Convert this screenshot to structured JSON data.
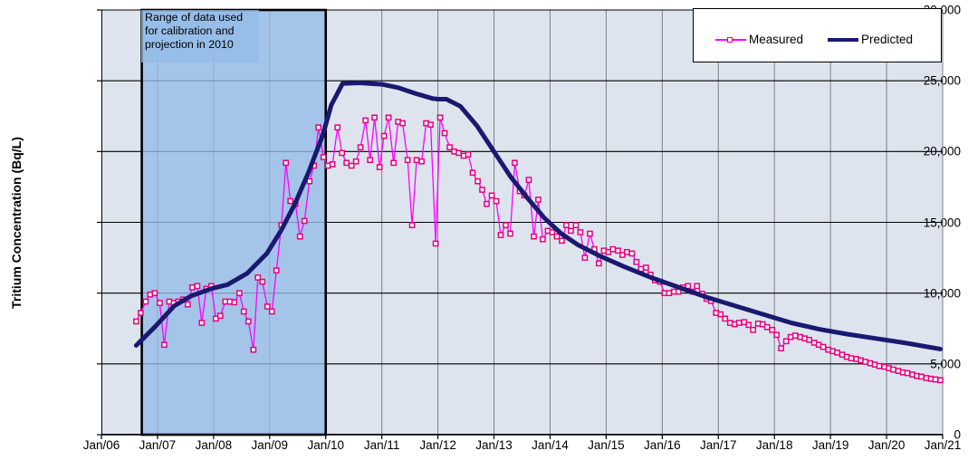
{
  "chart_data": {
    "type": "line",
    "title": "",
    "xlabel": "",
    "ylabel": "Tritium Concentration (Bq/L)",
    "ylim": [
      0,
      30000
    ],
    "yticks": [
      0,
      5000,
      10000,
      15000,
      20000,
      25000,
      30000
    ],
    "ytick_labels": [
      "0",
      "5,000",
      "10,000",
      "15,000",
      "20,000",
      "25,000",
      "30,000"
    ],
    "xtick_labels": [
      "Jan/06",
      "Jan/07",
      "Jan/08",
      "Jan/09",
      "Jan/10",
      "Jan/11",
      "Jan/12",
      "Jan/13",
      "Jan/14",
      "Jan/15",
      "Jan/16",
      "Jan/17",
      "Jan/18",
      "Jan/19",
      "Jan/20",
      "Jan/21"
    ],
    "xlim": [
      2006.0,
      2021.0
    ],
    "grid": "both",
    "legend_position": "top-right",
    "series": [
      {
        "name": "Measured",
        "color": "#FF00FF",
        "marker_edge": "#E8007D",
        "marker": "square-open",
        "x": [
          2006.62,
          2006.7,
          2006.79,
          2006.87,
          2006.95,
          2007.04,
          2007.12,
          2007.21,
          2007.29,
          2007.37,
          2007.46,
          2007.54,
          2007.62,
          2007.71,
          2007.79,
          2007.87,
          2007.96,
          2008.04,
          2008.12,
          2008.21,
          2008.29,
          2008.37,
          2008.46,
          2008.54,
          2008.62,
          2008.71,
          2008.79,
          2008.87,
          2008.96,
          2009.04,
          2009.12,
          2009.21,
          2009.29,
          2009.37,
          2009.46,
          2009.54,
          2009.62,
          2009.71,
          2009.79,
          2009.87,
          2009.96,
          2010.04,
          2010.12,
          2010.21,
          2010.29,
          2010.37,
          2010.46,
          2010.54,
          2010.62,
          2010.71,
          2010.79,
          2010.87,
          2010.96,
          2011.04,
          2011.12,
          2011.21,
          2011.29,
          2011.37,
          2011.46,
          2011.54,
          2011.62,
          2011.71,
          2011.79,
          2011.87,
          2011.96,
          2012.04,
          2012.12,
          2012.21,
          2012.29,
          2012.37,
          2012.46,
          2012.54,
          2012.62,
          2012.71,
          2012.79,
          2012.87,
          2012.96,
          2013.04,
          2013.12,
          2013.21,
          2013.29,
          2013.37,
          2013.46,
          2013.54,
          2013.62,
          2013.71,
          2013.79,
          2013.87,
          2013.96,
          2014.04,
          2014.12,
          2014.21,
          2014.29,
          2014.37,
          2014.46,
          2014.54,
          2014.62,
          2014.71,
          2014.79,
          2014.87,
          2014.96,
          2015.04,
          2015.12,
          2015.21,
          2015.29,
          2015.37,
          2015.46,
          2015.54,
          2015.62,
          2015.71,
          2015.79,
          2015.87,
          2015.96,
          2016.04,
          2016.12,
          2016.21,
          2016.29,
          2016.37,
          2016.46,
          2016.54,
          2016.62,
          2016.71,
          2016.79,
          2016.87,
          2016.96,
          2017.04,
          2017.12,
          2017.21,
          2017.29,
          2017.37,
          2017.46,
          2017.54,
          2017.62,
          2017.71,
          2017.79,
          2017.87,
          2017.96,
          2018.04,
          2018.12,
          2018.21,
          2018.29,
          2018.37,
          2018.46,
          2018.54,
          2018.62,
          2018.71,
          2018.79,
          2018.87,
          2018.96,
          2019.04,
          2019.12,
          2019.21,
          2019.29,
          2019.37,
          2019.46,
          2019.54,
          2019.62,
          2019.71,
          2019.79,
          2019.87,
          2019.96,
          2020.04,
          2020.12,
          2020.21,
          2020.29,
          2020.37,
          2020.46,
          2020.54,
          2020.62,
          2020.71,
          2020.79,
          2020.87,
          2020.96
        ],
        "y": [
          8000,
          8600,
          9400,
          9900,
          10000,
          9300,
          6350,
          9400,
          9300,
          9400,
          9550,
          9200,
          10400,
          10500,
          7900,
          10300,
          10500,
          8200,
          8400,
          9400,
          9400,
          9350,
          10000,
          8700,
          8000,
          6000,
          11100,
          10800,
          9050,
          8700,
          11600,
          14800,
          19200,
          16500,
          16300,
          14000,
          15100,
          17900,
          19000,
          21700,
          19600,
          19000,
          19100,
          21700,
          19900,
          19200,
          19000,
          19300,
          20300,
          22200,
          19400,
          22400,
          18900,
          21100,
          22400,
          19200,
          22100,
          22000,
          19400,
          14800,
          19400,
          19300,
          22000,
          21900,
          13500,
          22400,
          21300,
          20300,
          20000,
          19900,
          19700,
          19800,
          18500,
          17900,
          17300,
          16300,
          16900,
          16500,
          14100,
          14800,
          14200,
          19200,
          17200,
          16900,
          18000,
          14000,
          16600,
          13800,
          14400,
          14300,
          14000,
          13700,
          14800,
          14400,
          14800,
          14300,
          12500,
          14200,
          13100,
          12100,
          13000,
          12900,
          13100,
          13000,
          12700,
          12900,
          12800,
          12200,
          11700,
          11800,
          11300,
          10900,
          10800,
          10000,
          10000,
          10100,
          10100,
          10400,
          10500,
          10100,
          10500,
          9950,
          9600,
          9450,
          8600,
          8500,
          8200,
          7900,
          7800,
          7900,
          7950,
          7750,
          7400,
          7850,
          7800,
          7600,
          7400,
          7050,
          6100,
          6600,
          6900,
          7000,
          6900,
          6800,
          6700,
          6500,
          6350,
          6200,
          6000,
          5900,
          5800,
          5650,
          5500,
          5400,
          5350,
          5250,
          5150,
          5050,
          4950,
          4850,
          4800,
          4700,
          4600,
          4500,
          4400,
          4350,
          4250,
          4150,
          4100,
          4000,
          3950,
          3900,
          3850
        ]
      },
      {
        "name": "Predicted",
        "color": "#191970",
        "marker": "none",
        "x": [
          2006.62,
          2006.95,
          2007.3,
          2007.6,
          2007.95,
          2008.25,
          2008.6,
          2008.95,
          2009.2,
          2009.45,
          2009.7,
          2009.95,
          2010.1,
          2010.3,
          2010.6,
          2011.0,
          2011.3,
          2011.6,
          2011.9,
          2012.0,
          2012.15,
          2012.4,
          2012.7,
          2013.0,
          2013.3,
          2013.6,
          2013.9,
          2014.2,
          2014.5,
          2014.9,
          2015.3,
          2015.8,
          2016.3,
          2016.8,
          2017.3,
          2017.8,
          2018.3,
          2018.8,
          2019.3,
          2019.8,
          2020.3,
          2020.96
        ],
        "y": [
          6300,
          7600,
          9100,
          9800,
          10300,
          10600,
          11400,
          12800,
          14400,
          16300,
          18600,
          21200,
          23300,
          24800,
          24850,
          24750,
          24500,
          24100,
          23750,
          23700,
          23700,
          23200,
          21800,
          20000,
          18200,
          16700,
          15300,
          14200,
          13400,
          12600,
          11900,
          11100,
          10400,
          9700,
          9100,
          8500,
          7900,
          7450,
          7100,
          6800,
          6500,
          6050
        ]
      }
    ],
    "annotation": {
      "text": "Range of data used for calibration and projection in 2010",
      "x_start": "Jan/07",
      "x_end": "Jan/10",
      "fill_color": "#93bbe8",
      "border_color": "#000000"
    },
    "plot_bg": "#dde4ee",
    "gridline_color_vertical": "#808080",
    "gridline_color_horizontal": "#000000"
  },
  "legend": {
    "measured_label": "Measured",
    "predicted_label": "Predicted"
  },
  "axes": {
    "y_title": "Tritium Concentration (Bq/L)"
  },
  "annotation": {
    "line1": "Range of data used",
    "line2": "for calibration and",
    "line3": "projection in 2010",
    "full": "Range of data used for calibration and projection in 2010"
  }
}
